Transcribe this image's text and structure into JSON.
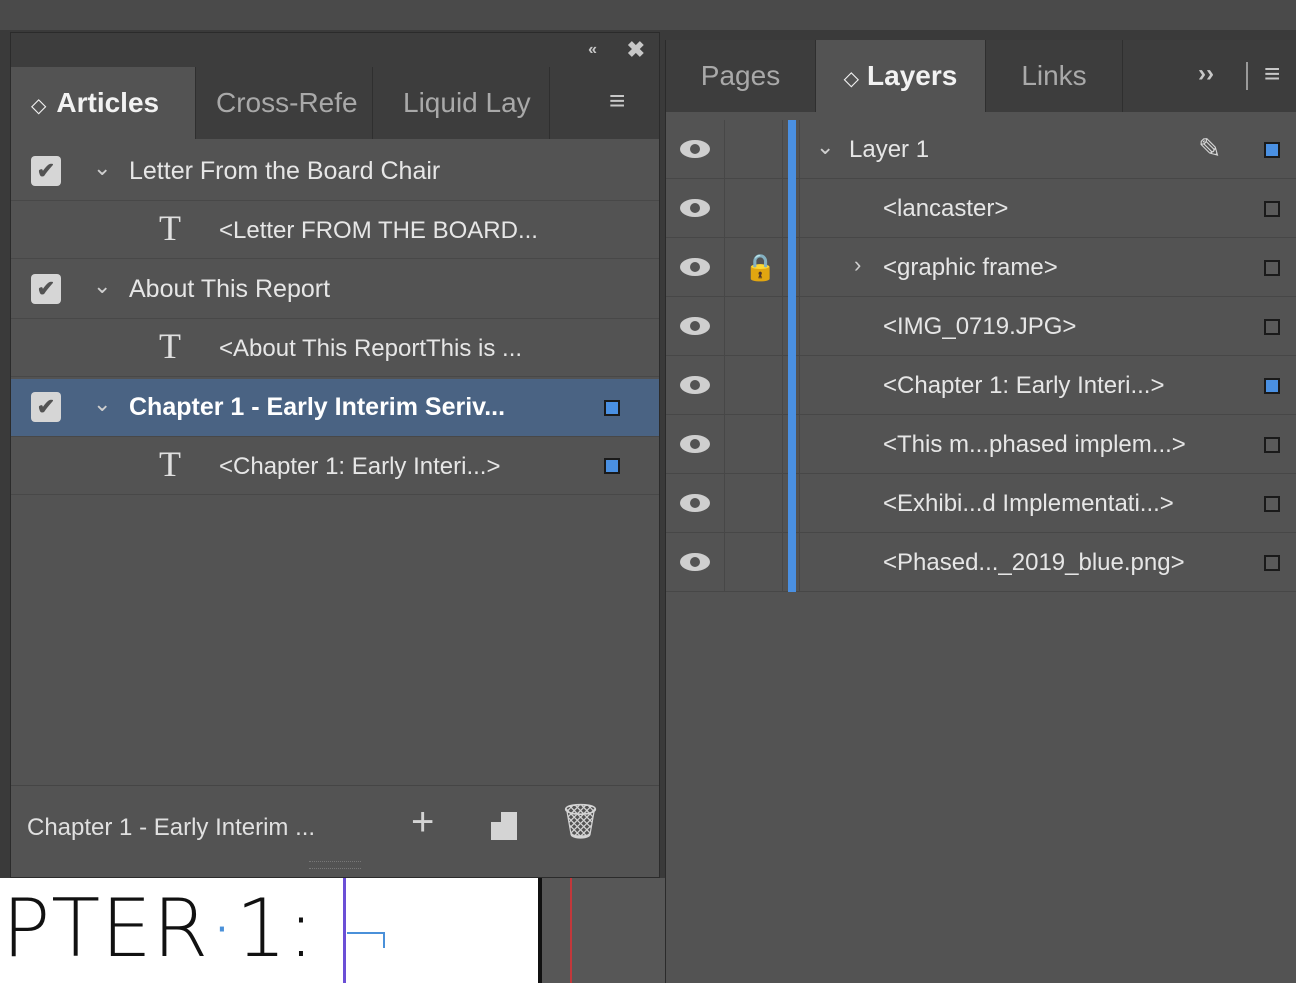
{
  "articles_panel": {
    "collapse_icon": "«",
    "close_icon": "✖",
    "tabs": [
      {
        "label": "Articles",
        "active": true
      },
      {
        "label": "Cross-Refe",
        "active": false
      },
      {
        "label": "Liquid Lay",
        "active": false
      }
    ],
    "updown_icon": "◇",
    "menu_icon": "≡",
    "items": [
      {
        "type": "article",
        "title": "Letter From the Board Chair",
        "checked": true,
        "selected": false
      },
      {
        "type": "story",
        "title": "<Letter FROM THE BOARD...",
        "marker": false
      },
      {
        "type": "article",
        "title": "About This Report",
        "checked": true,
        "selected": false
      },
      {
        "type": "story",
        "title": "<About This ReportThis is ...",
        "marker": false
      },
      {
        "type": "article",
        "title": "Chapter 1 - Early Interim Seriv...",
        "checked": true,
        "selected": true,
        "marker": true
      },
      {
        "type": "story",
        "title": "<Chapter 1: Early Interi...>",
        "marker": true
      }
    ],
    "checkmark_glyph": "✔",
    "disclosure_glyph": "⌄",
    "t_glyph": "T",
    "footer": {
      "label": "Chapter 1 - Early Interim ...",
      "plus_glyph": "+",
      "trash_glyph": "🗑"
    }
  },
  "layers_panel": {
    "tabs": [
      {
        "label": "Pages",
        "active": false
      },
      {
        "label": "Layers",
        "active": true
      },
      {
        "label": "Links",
        "active": false
      }
    ],
    "updown_icon": "◇",
    "overflow_icon": "››",
    "menu_icon": "≡",
    "layer": {
      "name": "Layer 1",
      "disclosure": "⌄",
      "pen_glyph": "✎"
    },
    "items": [
      {
        "name": "<lancaster>",
        "locked": false,
        "expandable": false,
        "selected": false
      },
      {
        "name": "<graphic frame>",
        "locked": true,
        "expandable": true,
        "selected": false
      },
      {
        "name": "<IMG_0719.JPG>",
        "locked": false,
        "expandable": false,
        "selected": false
      },
      {
        "name": "<Chapter 1: Early Interi...>",
        "locked": false,
        "expandable": false,
        "selected": true
      },
      {
        "name": "<This m...phased implem...>",
        "locked": false,
        "expandable": false,
        "selected": false
      },
      {
        "name": "<Exhibi...d Implementati...>",
        "locked": false,
        "expandable": false,
        "selected": false
      },
      {
        "name": "<Phased..._2019_blue.png>",
        "locked": false,
        "expandable": false,
        "selected": false
      }
    ],
    "lock_glyph": "🔒",
    "expand_glyph": "›"
  },
  "document": {
    "text_part1": "\\PTER",
    "text_dot": "·",
    "text_part2": "1:"
  },
  "colors": {
    "accent": "#4a90e2",
    "selected_row": "#4a6383",
    "panel_bg": "#535353"
  }
}
